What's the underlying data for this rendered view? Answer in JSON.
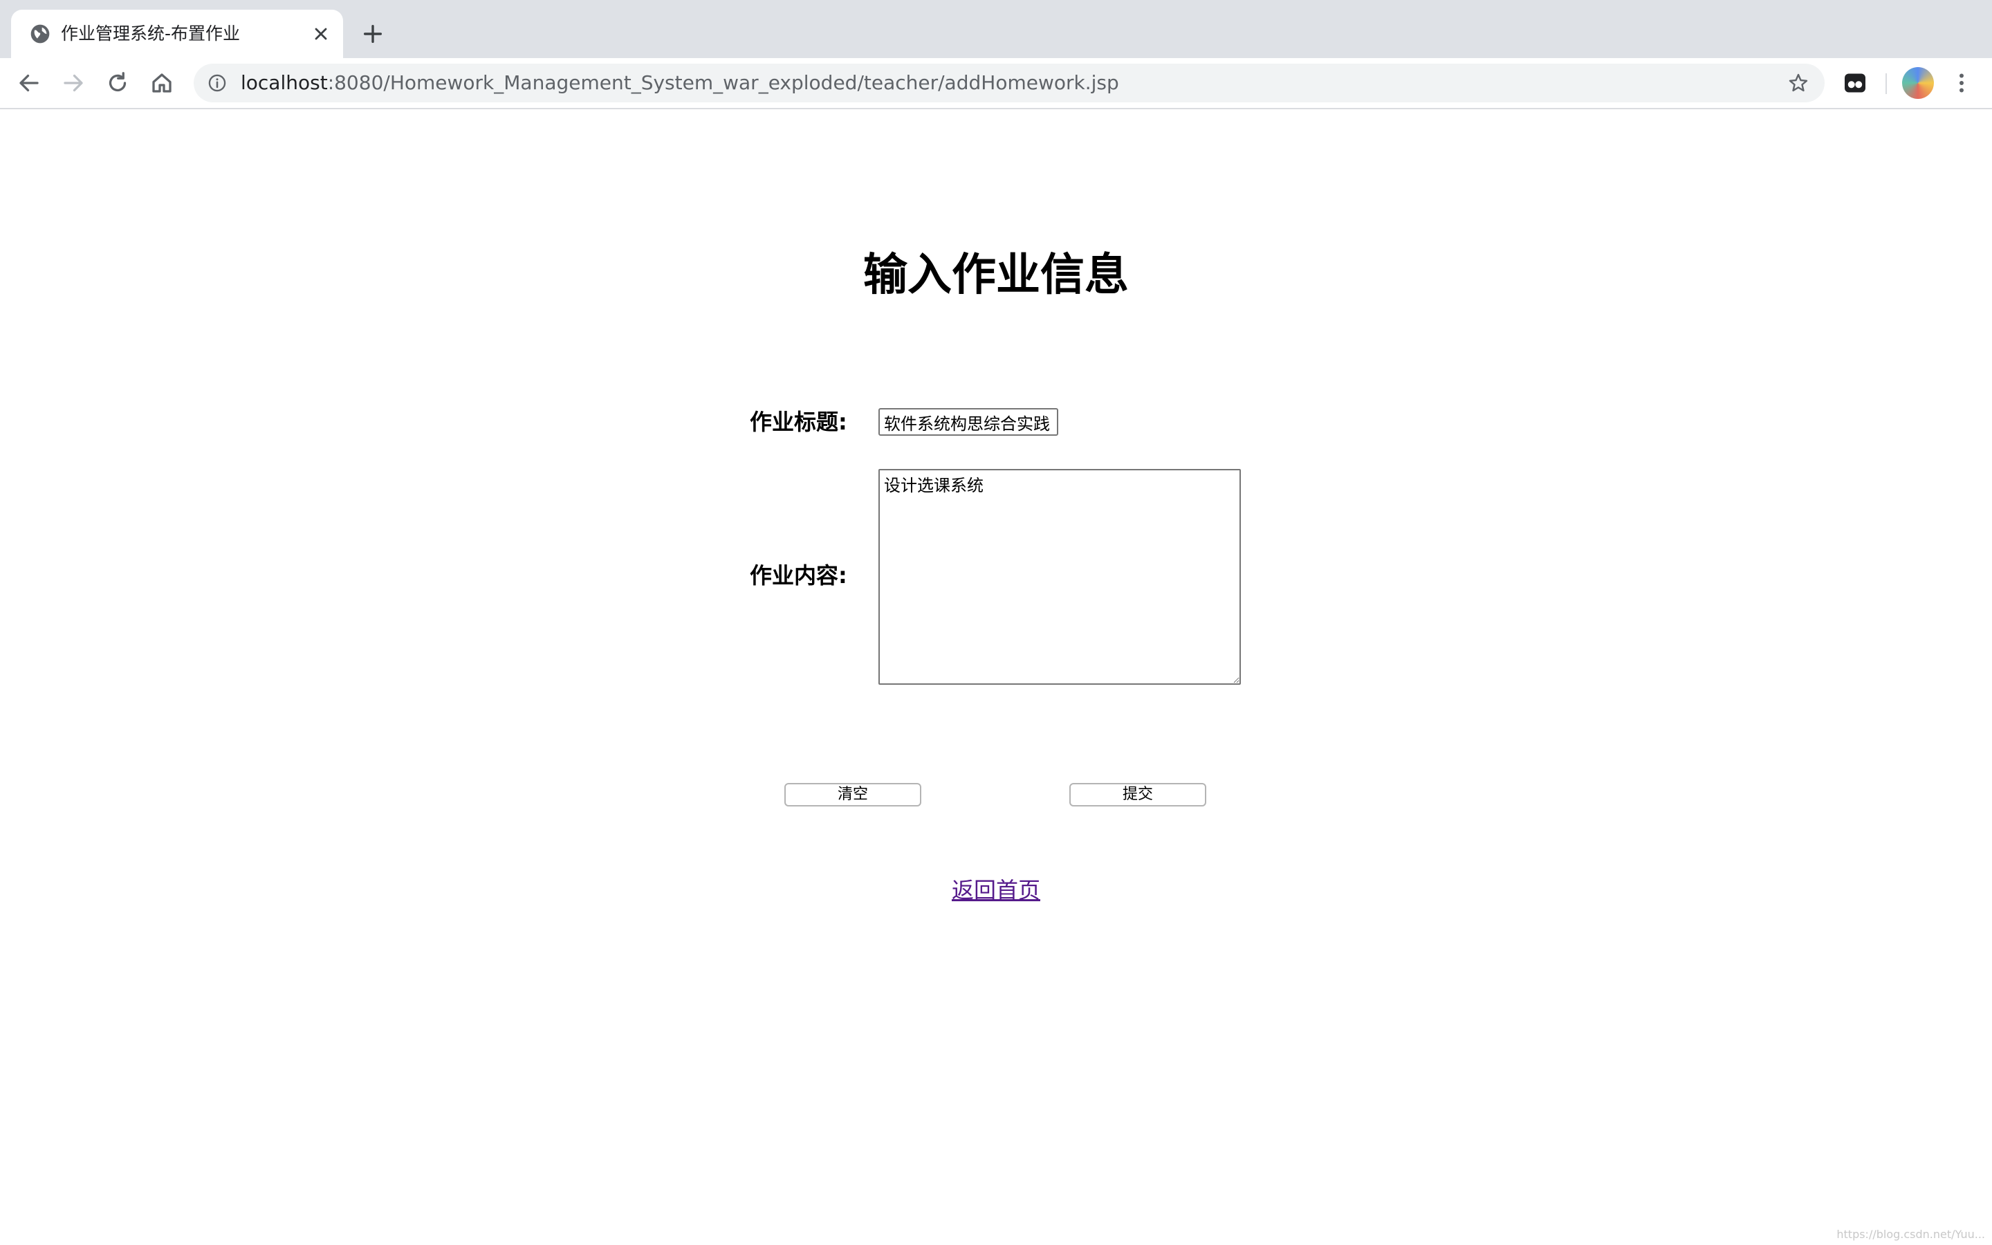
{
  "browser": {
    "tab_title": "作业管理系统-布置作业",
    "url_host": "localhost",
    "url_rest": ":8080/Homework_Management_System_war_exploded/teacher/addHomework.jsp"
  },
  "page": {
    "title": "输入作业信息",
    "form": {
      "title_label": "作业标题:",
      "title_value": "软件系统构思综合实践（",
      "content_label": "作业内容:",
      "content_value": "设计选课系统",
      "clear_button": "清空",
      "submit_button": "提交"
    },
    "back_link": "返回首页"
  },
  "watermark": "https://blog.csdn.net/Yuu..."
}
